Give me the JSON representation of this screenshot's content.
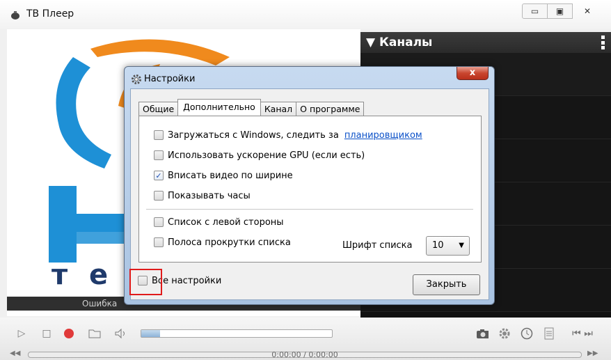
{
  "window": {
    "title": "ТВ Плеер",
    "controls": [
      "minimize",
      "maximize",
      "close"
    ]
  },
  "video": {
    "status_text": "Ошибка",
    "logo_letters": [
      "т",
      "е"
    ]
  },
  "channels": {
    "header": "Каналы",
    "rows": 6
  },
  "player": {
    "time": "0:00:00 / 0:00:00",
    "volume_fraction": 0.1
  },
  "dialog": {
    "title": "Настройки",
    "close_glyph": "x",
    "tabs": [
      "Общие",
      "Дополнительно",
      "Канал",
      "О программе"
    ],
    "active_tab": "Дополнительно",
    "options": [
      {
        "label": "Загружаться с Windows, следить за",
        "checked": false,
        "link": "планировщиком"
      },
      {
        "label": "Использовать ускорение GPU (если есть)",
        "checked": false
      },
      {
        "label": "Вписать видео по ширине",
        "checked": true
      },
      {
        "label": "Показывать часы",
        "checked": false
      },
      {
        "label": "Список с левой стороны",
        "checked": false
      },
      {
        "label": "Полоса прокрутки списка",
        "checked": false
      }
    ],
    "font_label": "Шрифт списка",
    "font_size": "10",
    "all_settings": "Все настройки",
    "close_button": "Закрыть"
  },
  "colors": {
    "highlight": "#e01b1b",
    "record": "#e03a3a",
    "logo_blue": "#1e90d6",
    "logo_orange": "#f08a1d"
  }
}
